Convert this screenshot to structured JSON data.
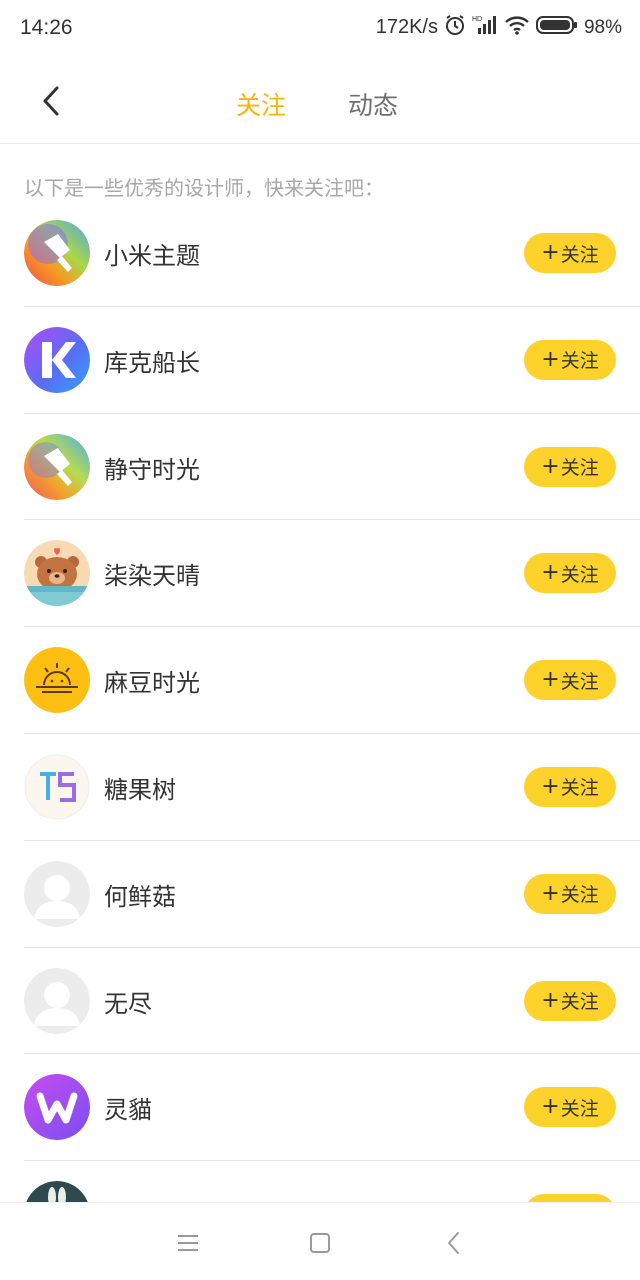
{
  "status_bar": {
    "time": "14:26",
    "speed": "172K/s",
    "battery": "98%"
  },
  "header": {
    "tabs": [
      {
        "label": "关注",
        "active": true
      },
      {
        "label": "动态",
        "active": false
      }
    ]
  },
  "intro_text": "以下是一些优秀的设计师，快来关注吧：",
  "follow_label": "关注",
  "designers": [
    {
      "name": "小米主题",
      "avatar_icon": "xiaomi-theme-brush-avatar"
    },
    {
      "name": "库克船长",
      "avatar_icon": "k-logo-avatar"
    },
    {
      "name": "静守时光",
      "avatar_icon": "brush-gradient-avatar"
    },
    {
      "name": "柒染天晴",
      "avatar_icon": "bear-avatar"
    },
    {
      "name": "麻豆时光",
      "avatar_icon": "sunrise-avatar"
    },
    {
      "name": "糖果树",
      "avatar_icon": "ts-logo-avatar"
    },
    {
      "name": "何鲜菇",
      "avatar_icon": "default-user-avatar"
    },
    {
      "name": "无尽",
      "avatar_icon": "default-user-avatar"
    },
    {
      "name": "灵貓",
      "avatar_icon": "w-logo-avatar"
    },
    {
      "name": "",
      "avatar_icon": "rabbit-avatar"
    }
  ],
  "colors": {
    "accent": "#fdd22a",
    "active_tab": "#f5b60f",
    "inactive_tab": "#6f6f6f"
  }
}
